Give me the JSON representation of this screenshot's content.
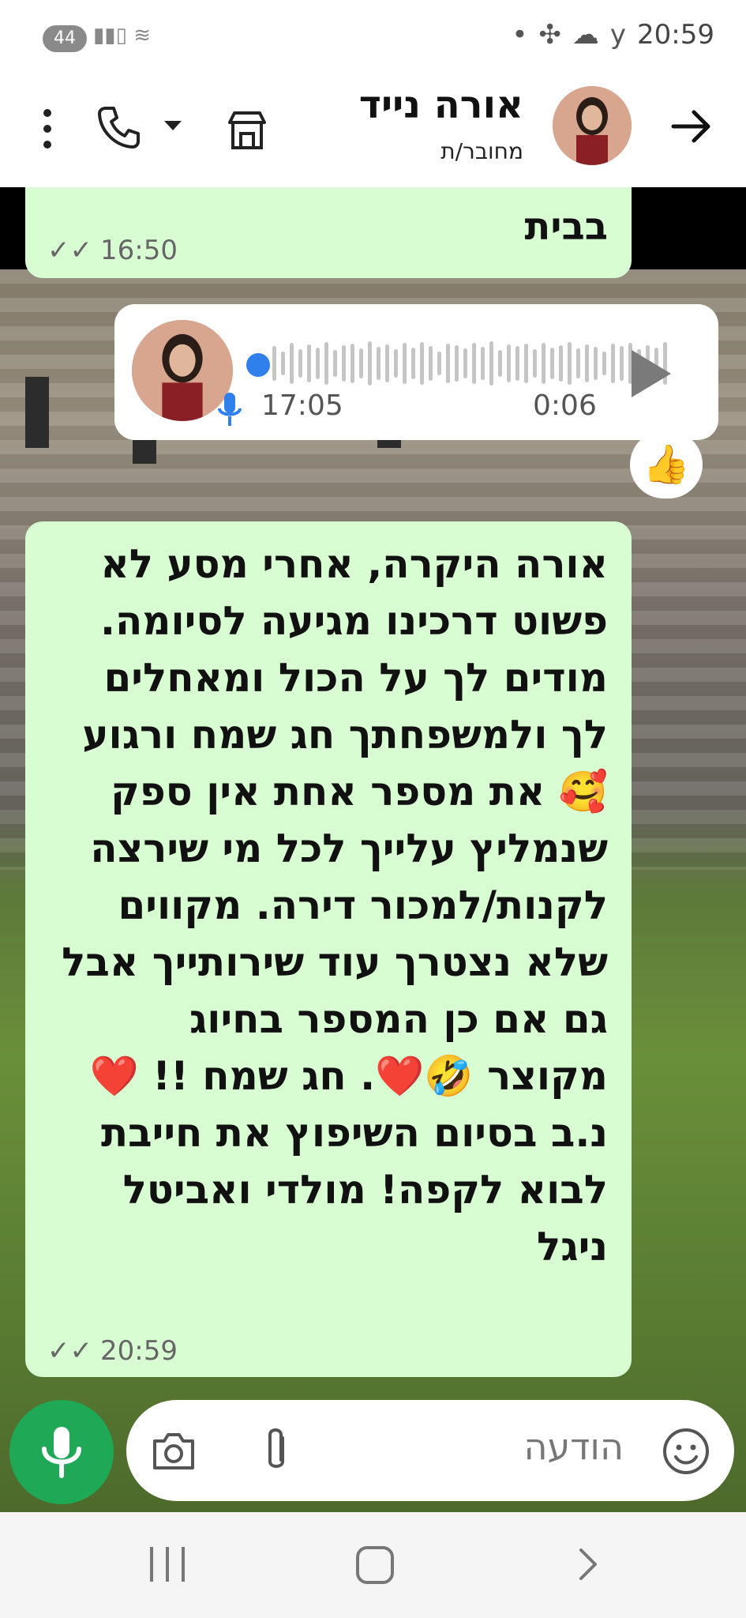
{
  "status_bar": {
    "badge": "44",
    "time": "20:59"
  },
  "header": {
    "contact_name": "אורה נייד",
    "contact_status": "מחובר/ת"
  },
  "messages": {
    "top_bubble": {
      "text": "בבית",
      "time": "16:50"
    },
    "voice_message": {
      "time": "17:05",
      "duration": "0:06"
    },
    "reaction": "👍",
    "main_bubble": {
      "text": "אורה היקרה, אחרי מסע לא פשוט דרכינו מגיעה לסיומה. מודים לך על הכול ומאחלים לך ולמשפחתך חג שמח ורגוע 🥰 את מספר אחת אין ספק שנמליץ עלייך לכל מי שירצה לקנות/למכור דירה. מקווים שלא נצטרך עוד שירותייך אבל גם אם כן המספר בחיוג מקוצר 🤣❤️. חג שמח !! ❤️ נ.ב בסיום השיפוץ את חייבת לבוא לקפה! מולדי ואביטל ניגל",
      "time": "20:59"
    }
  },
  "composer": {
    "placeholder": "הודעה"
  },
  "colors": {
    "bubble_green": "#d9fdd3",
    "mic_green": "#1fa855",
    "accent_blue": "#2f80ed"
  }
}
